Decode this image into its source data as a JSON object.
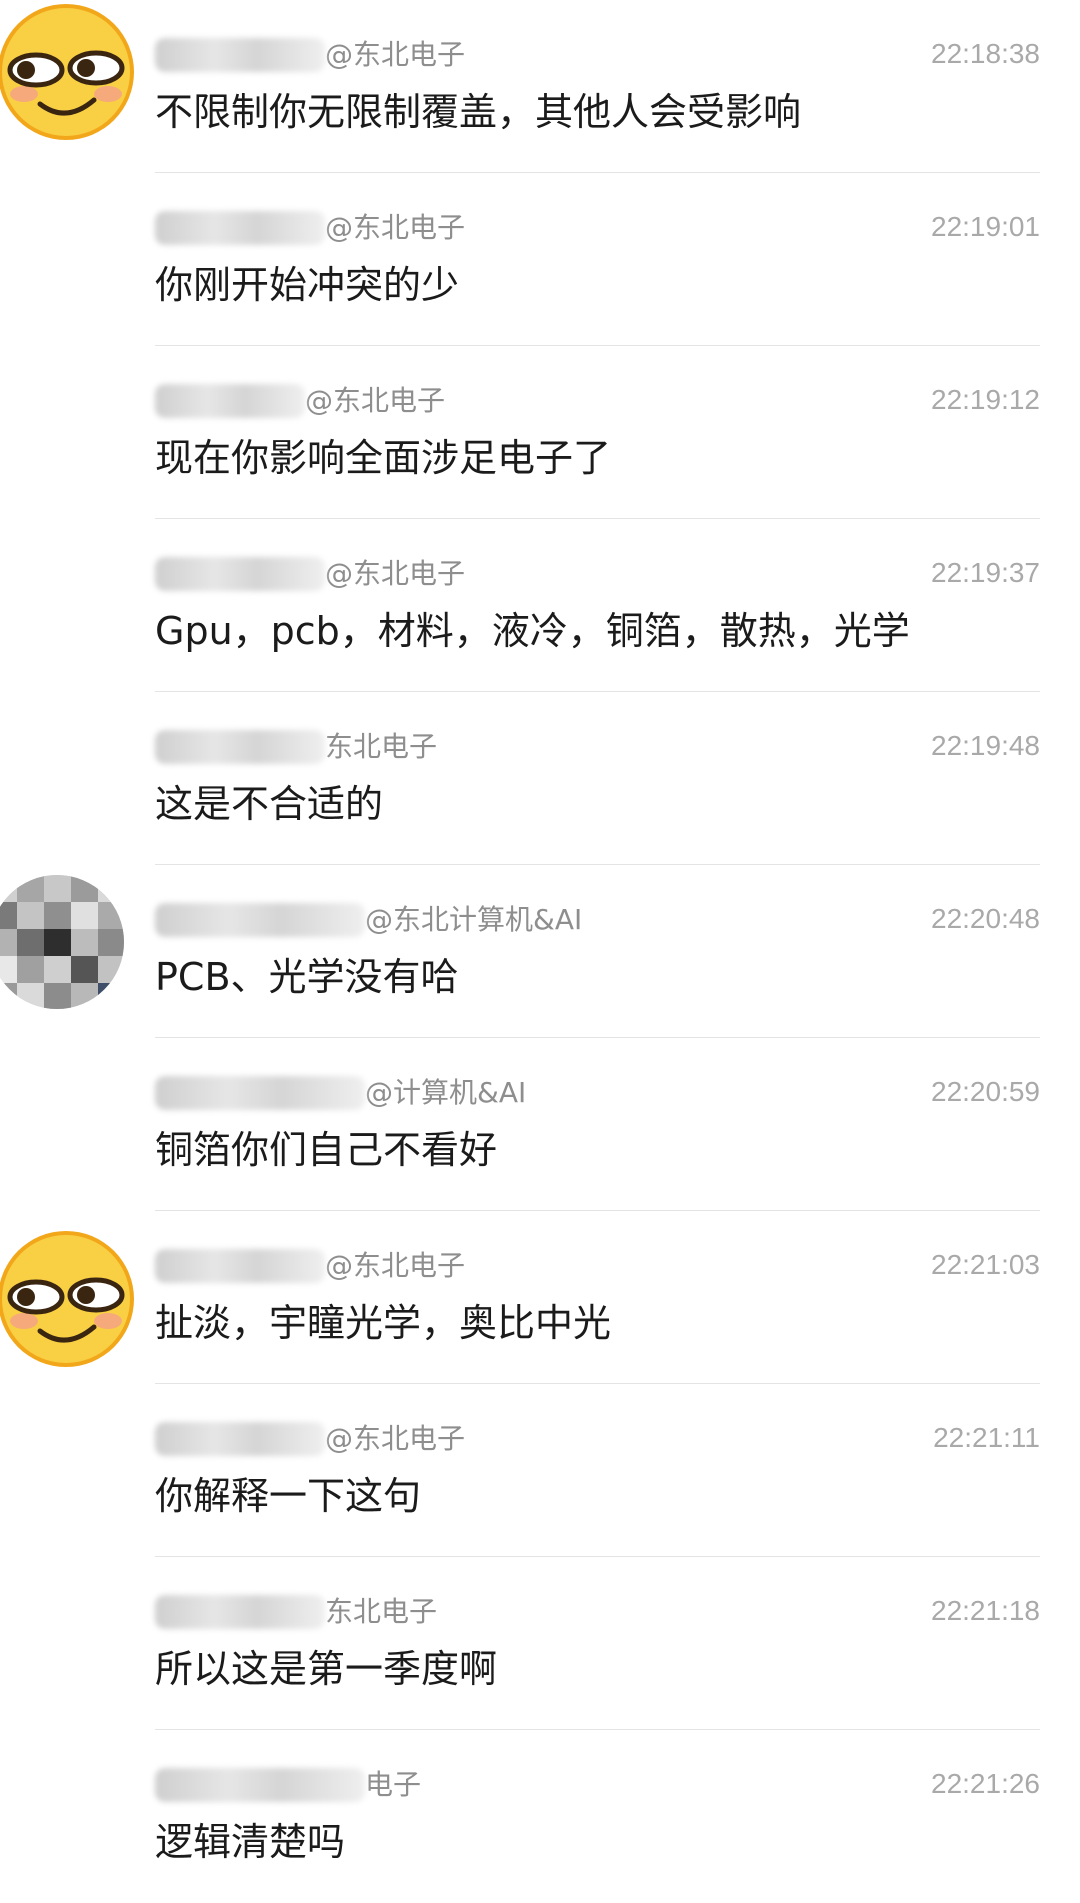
{
  "messages": [
    {
      "sender": "@东北电子",
      "time": "22:18:38",
      "text": "不限制你无限制覆盖，其他人会受影响",
      "avatar": "smirk-emoji"
    },
    {
      "sender": "@东北电子",
      "time": "22:19:01",
      "text": "你刚开始冲突的少",
      "avatar": ""
    },
    {
      "sender": "@东北电子",
      "time": "22:19:12",
      "text": "现在你影响全面涉足电子了",
      "avatar": ""
    },
    {
      "sender": "@东北电子",
      "time": "22:19:37",
      "text": "Gpu，pcb，材料，液冷，铜箔，散热，光学",
      "avatar": ""
    },
    {
      "sender": "东北电子",
      "time": "22:19:48",
      "text": "这是不合适的",
      "avatar": ""
    },
    {
      "sender": "@东北计算机&AI",
      "time": "22:20:48",
      "text": "PCB、光学没有哈",
      "avatar": "pixelated-avatar"
    },
    {
      "sender": "@计算机&AI",
      "time": "22:20:59",
      "text": "铜箔你们自己不看好",
      "avatar": ""
    },
    {
      "sender": "@东北电子",
      "time": "22:21:03",
      "text": "扯淡，宇瞳光学，奥比中光",
      "avatar": "smirk-emoji"
    },
    {
      "sender": "@东北电子",
      "time": "22:21:11",
      "text": "你解释一下这句",
      "avatar": ""
    },
    {
      "sender": "东北电子",
      "time": "22:21:18",
      "text": "所以这是第一季度啊",
      "avatar": ""
    },
    {
      "sender": "电子",
      "time": "22:21:26",
      "text": "逻辑清楚吗",
      "avatar": ""
    }
  ],
  "colors": {
    "divider": "#e4e4e4",
    "sender": "#8e8e8e",
    "time": "#a9a9a9",
    "text": "#1b1b1b",
    "emoji_face": "#f7c33a"
  }
}
